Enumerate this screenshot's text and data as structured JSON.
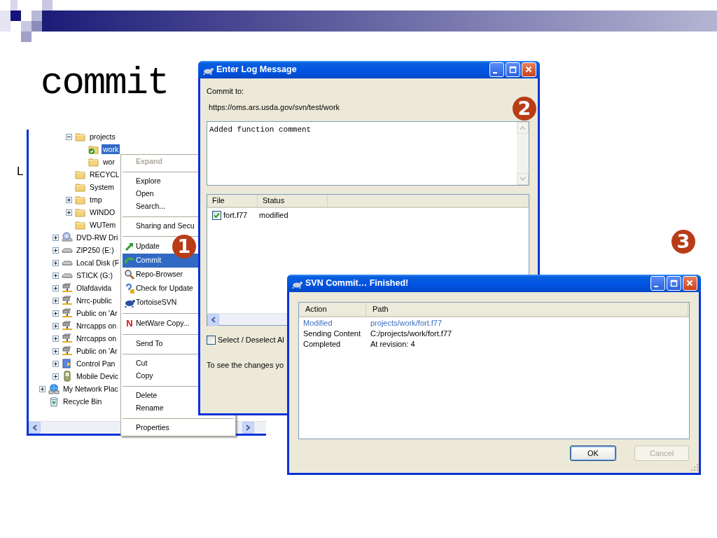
{
  "slide": {
    "title": "commit",
    "fragment": "L"
  },
  "explorer": {
    "tree": [
      {
        "children": [
          {
            "children": [
              {
                "label": "projects",
                "kind": "folder",
                "expanded": true,
                "selected": false,
                "children": [
                  {
                    "label": "work",
                    "kind": "svn-folder",
                    "selected": true
                  },
                  {
                    "label": "wor",
                    "kind": "folder",
                    "selected": false
                  }
                ]
              },
              {
                "label": "RECYCL",
                "kind": "folder",
                "selected": false
              },
              {
                "label": "System",
                "kind": "folder",
                "selected": false
              },
              {
                "label": "tmp",
                "kind": "folder",
                "expanded": false,
                "selected": false
              },
              {
                "label": "WINDO",
                "kind": "folder",
                "expanded": false,
                "selected": false
              },
              {
                "label": "WUTem",
                "kind": "folder",
                "selected": false
              }
            ]
          },
          {
            "label": "DVD-RW Dri",
            "kind": "optical",
            "expanded": false,
            "selected": false
          },
          {
            "label": "ZIP250 (E:)",
            "kind": "drive",
            "expanded": false,
            "selected": false
          },
          {
            "label": "Local Disk (F",
            "kind": "drive",
            "expanded": false,
            "selected": false
          },
          {
            "label": "STICK (G:)",
            "kind": "drive",
            "expanded": false,
            "selected": false
          },
          {
            "label": "Olafdavida",
            "kind": "network",
            "expanded": false,
            "selected": false
          },
          {
            "label": "Nrrc-public",
            "kind": "network",
            "expanded": false,
            "selected": false
          },
          {
            "label": "Public on 'Ar",
            "kind": "network",
            "expanded": false,
            "selected": false
          },
          {
            "label": "Nrrcapps on",
            "kind": "network",
            "expanded": false,
            "selected": false
          },
          {
            "label": "Nrrcapps on",
            "kind": "network",
            "expanded": false,
            "selected": false
          },
          {
            "label": "Public on 'Ar",
            "kind": "network",
            "expanded": false,
            "selected": false
          },
          {
            "label": "Control Pan",
            "kind": "control",
            "expanded": false,
            "selected": false
          },
          {
            "label": "Mobile Devic",
            "kind": "device",
            "expanded": false,
            "selected": false
          }
        ]
      },
      {
        "label": "My Network Plac",
        "kind": "places",
        "expanded": false,
        "selected": false
      },
      {
        "label": "Recycle Bin",
        "kind": "recycle",
        "selected": false
      }
    ]
  },
  "context_menu": {
    "items": [
      {
        "kind": "plain",
        "label": "Expand",
        "default": true,
        "disabled": true,
        "selected": false
      },
      {
        "kind": "separator"
      },
      {
        "kind": "plain",
        "label": "Explore",
        "default": false,
        "disabled": false,
        "selected": false
      },
      {
        "kind": "plain",
        "label": "Open",
        "default": false,
        "disabled": false,
        "selected": false
      },
      {
        "kind": "plain",
        "label": "Search...",
        "default": false,
        "disabled": false,
        "selected": false
      },
      {
        "kind": "separator"
      },
      {
        "kind": "plain",
        "label": "Sharing and Secu",
        "default": false,
        "disabled": false,
        "selected": false
      },
      {
        "kind": "separator"
      },
      {
        "kind": "icon",
        "label": "Update",
        "default": false,
        "disabled": false,
        "selected": false
      },
      {
        "kind": "icon",
        "label": "Commit",
        "default": false,
        "disabled": false,
        "selected": true
      },
      {
        "kind": "icon",
        "label": "Repo-Browser",
        "default": false,
        "disabled": false,
        "selected": false
      },
      {
        "kind": "icon",
        "label": "Check for Update",
        "default": false,
        "disabled": false,
        "selected": false
      },
      {
        "kind": "icon",
        "label": "TortoiseSVN",
        "default": false,
        "disabled": false,
        "selected": false
      },
      {
        "kind": "separator"
      },
      {
        "kind": "letter",
        "letter": "N",
        "label": "NetWare Copy...",
        "default": false,
        "disabled": false,
        "selected": false
      },
      {
        "kind": "separator"
      },
      {
        "kind": "plain",
        "label": "Send To",
        "default": false,
        "disabled": false,
        "selected": false
      },
      {
        "kind": "separator"
      },
      {
        "kind": "plain",
        "label": "Cut",
        "default": false,
        "disabled": false,
        "selected": false
      },
      {
        "kind": "plain",
        "label": "Copy",
        "default": false,
        "disabled": false,
        "selected": false
      },
      {
        "kind": "separator"
      },
      {
        "kind": "plain",
        "label": "Delete",
        "default": false,
        "disabled": false,
        "selected": false
      },
      {
        "kind": "plain",
        "label": "Rename",
        "default": false,
        "disabled": false,
        "selected": false
      },
      {
        "kind": "separator"
      },
      {
        "kind": "plain",
        "label": "Properties",
        "default": false,
        "disabled": false,
        "selected": false
      }
    ]
  },
  "log_dialog": {
    "title": "Enter Log Message",
    "commit_to_label": "Commit to:",
    "url": "https://oms.ars.usda.gov/svn/test/work",
    "message": "Added function comment",
    "columns": [
      "File",
      "Status"
    ],
    "rows": [
      {
        "checked": true,
        "file": "fort.f77",
        "status": "modified"
      }
    ],
    "select_all": {
      "label": "Select / Deselect Al",
      "checked": false
    },
    "hint": "To see the changes yo"
  },
  "finished_dialog": {
    "title": "SVN Commit… Finished!",
    "columns": [
      "Action",
      "Path"
    ],
    "rows": [
      {
        "action": "Modified",
        "path": "projects/work/fort.f77",
        "highlighted": true
      },
      {
        "action": "Sending Content",
        "path": "C:/projects/work/fort.f77",
        "highlighted": false
      },
      {
        "action": "Completed",
        "path": "At revision: 4",
        "highlighted": false
      }
    ],
    "buttons": [
      {
        "label": "OK",
        "default": true,
        "disabled": false
      },
      {
        "label": "Cancel",
        "default": false,
        "disabled": true
      }
    ]
  },
  "callouts": [
    {
      "number": "1"
    },
    {
      "number": "2"
    },
    {
      "number": "3"
    }
  ]
}
